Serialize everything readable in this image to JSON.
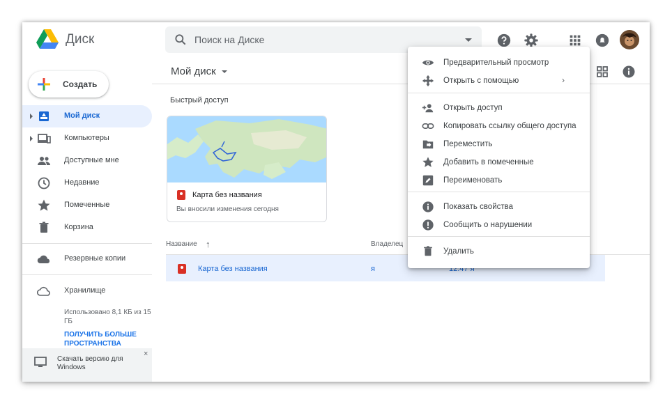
{
  "app": {
    "title": "Диск"
  },
  "search": {
    "placeholder": "Поиск на Диске"
  },
  "create_button": {
    "label": "Создать"
  },
  "sidebar": {
    "items": [
      {
        "label": "Мой диск",
        "icon": "my-drive-icon",
        "active": true
      },
      {
        "label": "Компьютеры",
        "icon": "computers-icon"
      },
      {
        "label": "Доступные мне",
        "icon": "shared-with-me-icon"
      },
      {
        "label": "Недавние",
        "icon": "clock-icon"
      },
      {
        "label": "Помеченные",
        "icon": "star-icon"
      },
      {
        "label": "Корзина",
        "icon": "trash-icon"
      },
      {
        "label": "Резервные копии",
        "icon": "cloud-icon"
      },
      {
        "label": "Хранилище",
        "icon": "cloud-outline-icon"
      }
    ],
    "storage_used": "Использовано 8,1 КБ из 15 ГБ",
    "storage_link": "ПОЛУЧИТЬ БОЛЬШЕ ПРОСТРАНСТВА",
    "download": {
      "label": "Скачать версию для Windows",
      "close": "×"
    }
  },
  "main": {
    "title": "Мой диск",
    "quick_access": {
      "title": "Быстрый доступ",
      "card": {
        "name": "Карта без названия",
        "desc": "Вы вносили изменения сегодня"
      }
    },
    "table": {
      "headers": {
        "name": "Название",
        "sort_arrow": "↑",
        "owner": "Владелец"
      },
      "rows": [
        {
          "name": "Карта без названия",
          "owner": "я",
          "modified": "12:47 я"
        }
      ]
    }
  },
  "context_menu": {
    "items": [
      {
        "label": "Предварительный просмотр",
        "icon": "eye-icon"
      },
      {
        "label": "Открыть с помощью",
        "icon": "open-with-icon",
        "submenu": "›"
      },
      {
        "label": "Открыть доступ",
        "icon": "add-person-icon"
      },
      {
        "label": "Копировать ссылку общего доступа",
        "icon": "link-icon"
      },
      {
        "label": "Переместить",
        "icon": "move-folder-icon"
      },
      {
        "label": "Добавить в помеченные",
        "icon": "star-icon"
      },
      {
        "label": "Переименовать",
        "icon": "rename-icon"
      },
      {
        "label": "Показать свойства",
        "icon": "info-icon"
      },
      {
        "label": "Сообщить о нарушении",
        "icon": "report-icon"
      },
      {
        "label": "Удалить",
        "icon": "trash-icon"
      }
    ]
  },
  "colors": {
    "accent": "#1967d2",
    "active_bg": "#e8f0fe",
    "icon": "#5f6368"
  }
}
